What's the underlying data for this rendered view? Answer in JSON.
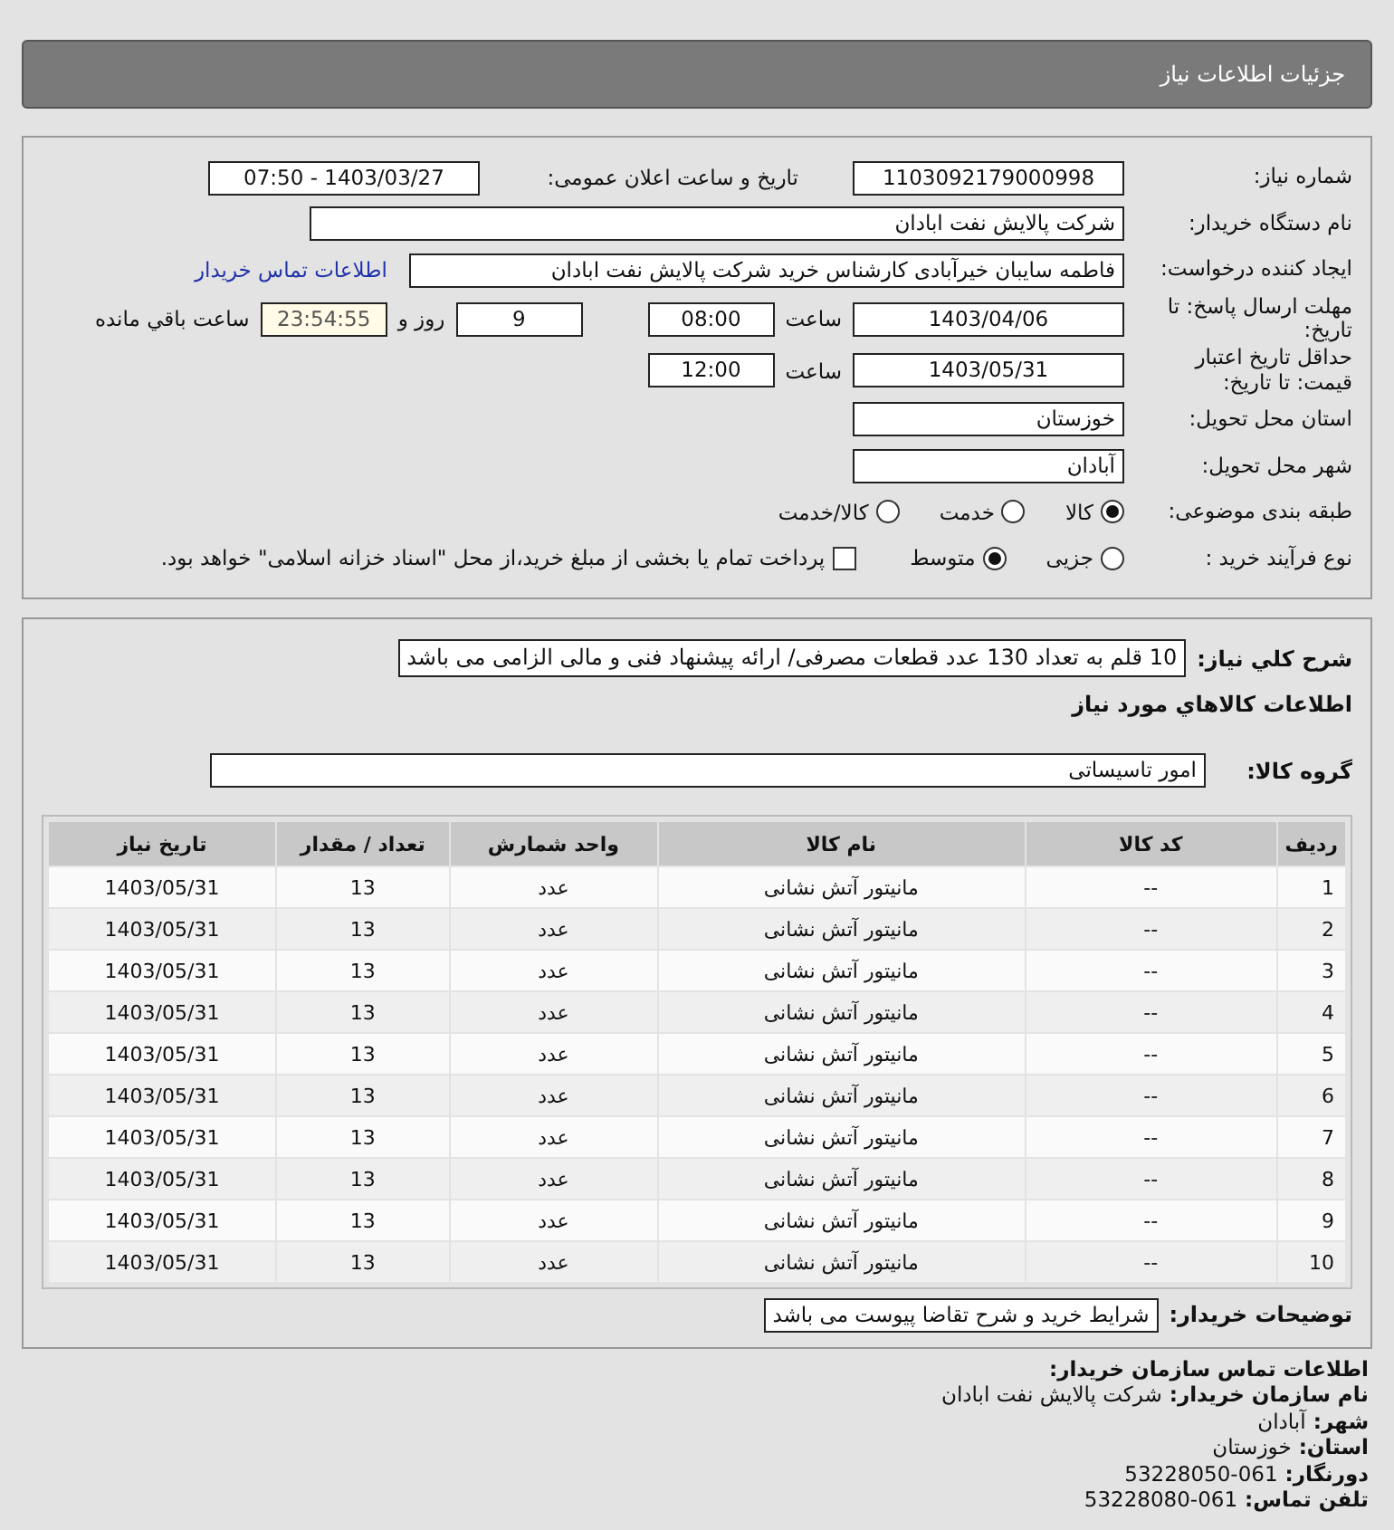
{
  "header": {
    "title": "جزئیات اطلاعات نیاز"
  },
  "details": {
    "need_number": {
      "label": "شماره نیاز:",
      "value": "1103092179000998"
    },
    "announce": {
      "label": "تاریخ و ساعت اعلان عمومی:",
      "value": "1403/03/27 - 07:50"
    },
    "buyer_org": {
      "label": "نام دستگاه خریدار:",
      "value": "شرکت پالایش نفت ابادان"
    },
    "creator": {
      "label": "ایجاد کننده درخواست:",
      "value": "فاطمه سایبان خیرآبادی کارشناس خرید شرکت پالایش نفت ابادان",
      "link": "اطلاعات تماس خریدار"
    },
    "deadline": {
      "label": "مهلت ارسال پاسخ: تا تاریخ:",
      "date": "1403/04/06",
      "time_label": "ساعت",
      "time": "08:00",
      "days": "9",
      "days_label": "روز و",
      "remaining": "23:54:55",
      "remaining_label": "ساعت باقي مانده"
    },
    "validity": {
      "label": "حداقل تاریخ اعتبار قیمت: تا تاریخ:",
      "date": "1403/05/31",
      "time_label": "ساعت",
      "time": "12:00"
    },
    "province": {
      "label": "استان محل تحویل:",
      "value": "خوزستان"
    },
    "city": {
      "label": "شهر محل تحویل:",
      "value": "آبادان"
    },
    "category": {
      "label": "طبقه بندی موضوعی:",
      "options": [
        {
          "label": "کالا",
          "selected": true
        },
        {
          "label": "خدمت",
          "selected": false
        },
        {
          "label": "کالا/خدمت",
          "selected": false
        }
      ]
    },
    "process": {
      "label": "نوع فرآیند خرید :",
      "options": [
        {
          "label": "جزیی",
          "selected": false
        },
        {
          "label": "متوسط",
          "selected": true
        }
      ],
      "payment": {
        "label": "پرداخت تمام یا بخشی از مبلغ خرید،از محل \"اسناد خزانه اسلامی\" خواهد بود.",
        "checked": false
      }
    }
  },
  "summary": {
    "label": "شرح کلي نیاز:",
    "value": "10 قلم به تعداد 130 عدد قطعات مصرفی/ ارائه پیشنهاد فنی و مالی الزامی می باشد"
  },
  "goods_title": "اطلاعات کالاهاي مورد نیاز",
  "goods_group": {
    "label": "گروه کالا:",
    "value": "امور تاسیساتی"
  },
  "table": {
    "columns": [
      "ردیف",
      "کد کالا",
      "نام کالا",
      "واحد شمارش",
      "تعداد / مقدار",
      "تاریخ نیاز"
    ],
    "rows": [
      [
        "1",
        "--",
        "مانیتور آتش نشانی",
        "عدد",
        "13",
        "1403/05/31"
      ],
      [
        "2",
        "--",
        "مانیتور آتش نشانی",
        "عدد",
        "13",
        "1403/05/31"
      ],
      [
        "3",
        "--",
        "مانیتور آتش نشانی",
        "عدد",
        "13",
        "1403/05/31"
      ],
      [
        "4",
        "--",
        "مانیتور آتش نشانی",
        "عدد",
        "13",
        "1403/05/31"
      ],
      [
        "5",
        "--",
        "مانیتور آتش نشانی",
        "عدد",
        "13",
        "1403/05/31"
      ],
      [
        "6",
        "--",
        "مانیتور آتش نشانی",
        "عدد",
        "13",
        "1403/05/31"
      ],
      [
        "7",
        "--",
        "مانیتور آتش نشانی",
        "عدد",
        "13",
        "1403/05/31"
      ],
      [
        "8",
        "--",
        "مانیتور آتش نشانی",
        "عدد",
        "13",
        "1403/05/31"
      ],
      [
        "9",
        "--",
        "مانیتور آتش نشانی",
        "عدد",
        "13",
        "1403/05/31"
      ],
      [
        "10",
        "--",
        "مانیتور آتش نشانی",
        "عدد",
        "13",
        "1403/05/31"
      ]
    ]
  },
  "buyer_notes": {
    "label": "توضیحات خریدار:",
    "value": "شرایط خرید و شرح تقاضا پیوست می باشد"
  },
  "contact": {
    "title": "اطلاعات تماس سازمان خریدار:",
    "items": [
      {
        "label": "نام سازمان خریدار:",
        "value": "شرکت پالایش نفت ابادان"
      },
      {
        "label": "شهر:",
        "value": "آبادان"
      },
      {
        "label": "استان:",
        "value": "خوزستان"
      },
      {
        "label": "دورنگار:",
        "value": "061-53228050"
      },
      {
        "label": "تلفن تماس:",
        "value": "061-53228080"
      }
    ]
  }
}
